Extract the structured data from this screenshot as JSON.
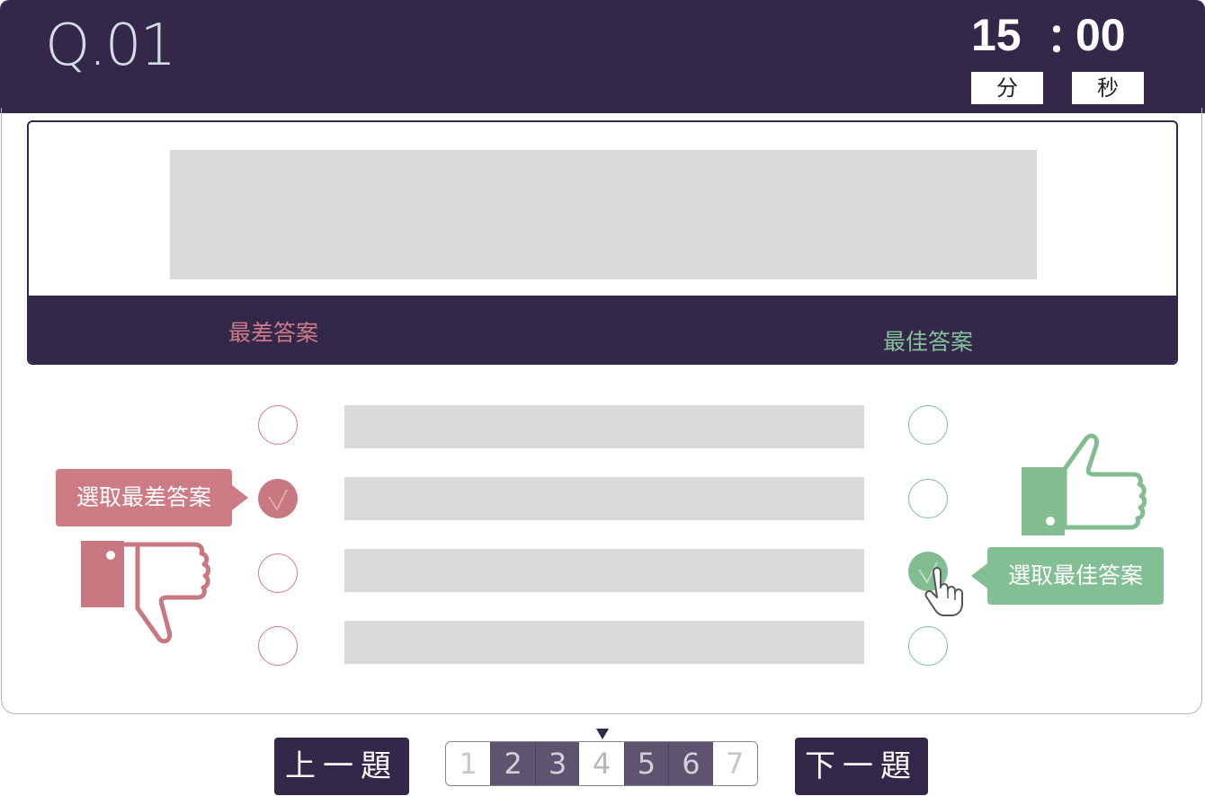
{
  "header": {
    "question_number": "Q.01",
    "timer": {
      "minutes": "15",
      "separator": "：",
      "seconds": "00",
      "minutes_unit": "分",
      "seconds_unit": "秒"
    }
  },
  "question": {
    "worst_column_label": "最差答案",
    "best_column_label": "最佳答案"
  },
  "options": [
    {
      "worst_selected": false,
      "best_selected": false
    },
    {
      "worst_selected": true,
      "best_selected": false
    },
    {
      "worst_selected": false,
      "best_selected": true
    },
    {
      "worst_selected": false,
      "best_selected": false
    }
  ],
  "hints": {
    "select_worst": "選取最差答案",
    "select_best": "選取最佳答案"
  },
  "navigation": {
    "prev_label": "上一題",
    "next_label": "下一題",
    "pages": [
      "1",
      "2",
      "3",
      "4",
      "5",
      "6",
      "7"
    ],
    "current_page": "4"
  },
  "colors": {
    "header_bg": "#34284a",
    "worst_accent": "#cd7c86",
    "best_accent": "#83bf95",
    "placeholder": "#d9d9d9"
  },
  "icons": {
    "thumbs_down": "thumbs-down-icon",
    "thumbs_up": "thumbs-up-icon",
    "pointer": "hand-pointer-icon",
    "check": "check-icon"
  }
}
